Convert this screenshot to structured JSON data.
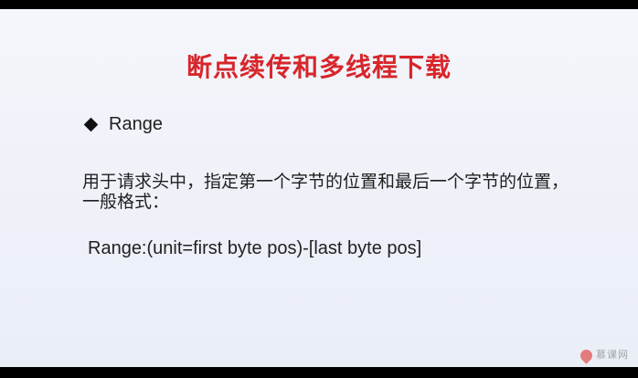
{
  "slide": {
    "title": "断点续传和多线程下载",
    "bullet": {
      "icon": "diamond-bullet-icon",
      "label": "Range"
    },
    "description": "用于请求头中，指定第一个字节的位置和最后一个字节的位置，\n一般格式：",
    "format": "Range:(unit=first byte pos)-[last byte pos]",
    "watermark": {
      "icon": "flame-logo-icon",
      "text": "慕课网"
    }
  },
  "colors": {
    "title": "#d7262b",
    "text": "#1f1f1f",
    "background": "#f0f3f9",
    "letterbox": "#000000"
  }
}
